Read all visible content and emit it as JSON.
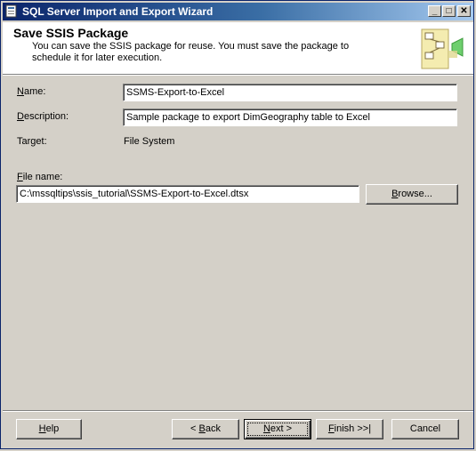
{
  "window": {
    "title": "SQL Server Import and Export Wizard"
  },
  "titlebar_buttons": {
    "minimize": "_",
    "maximize": "□",
    "close": "✕"
  },
  "header": {
    "title": "Save SSIS Package",
    "description": "You can save the SSIS package for reuse. You must save the package to schedule it for later execution."
  },
  "form": {
    "name_label_mnemonic": "N",
    "name_label_rest": "ame:",
    "name_value": "SSMS-Export-to-Excel",
    "description_label_mnemonic": "D",
    "description_label_rest": "escription:",
    "description_value": "Sample package to export DimGeography table to Excel",
    "target_label": "Target:",
    "target_value": "File System",
    "filename_label_mnemonic": "F",
    "filename_label_rest": "ile name:",
    "filename_value": "C:\\mssqltips\\ssis_tutorial\\SSMS-Export-to-Excel.dtsx",
    "browse_mnemonic": "B",
    "browse_rest": "rowse..."
  },
  "buttons": {
    "help_mnemonic": "H",
    "help_rest": "elp",
    "back_prefix": "< ",
    "back_mnemonic": "B",
    "back_rest": "ack",
    "next_mnemonic": "N",
    "next_rest": "ext >",
    "finish_mnemonic": "F",
    "finish_rest": "inish >>|",
    "cancel": "Cancel"
  },
  "colors": {
    "titlebar_start": "#0a246a",
    "titlebar_end": "#a6caf0",
    "face": "#d4d0c8"
  }
}
